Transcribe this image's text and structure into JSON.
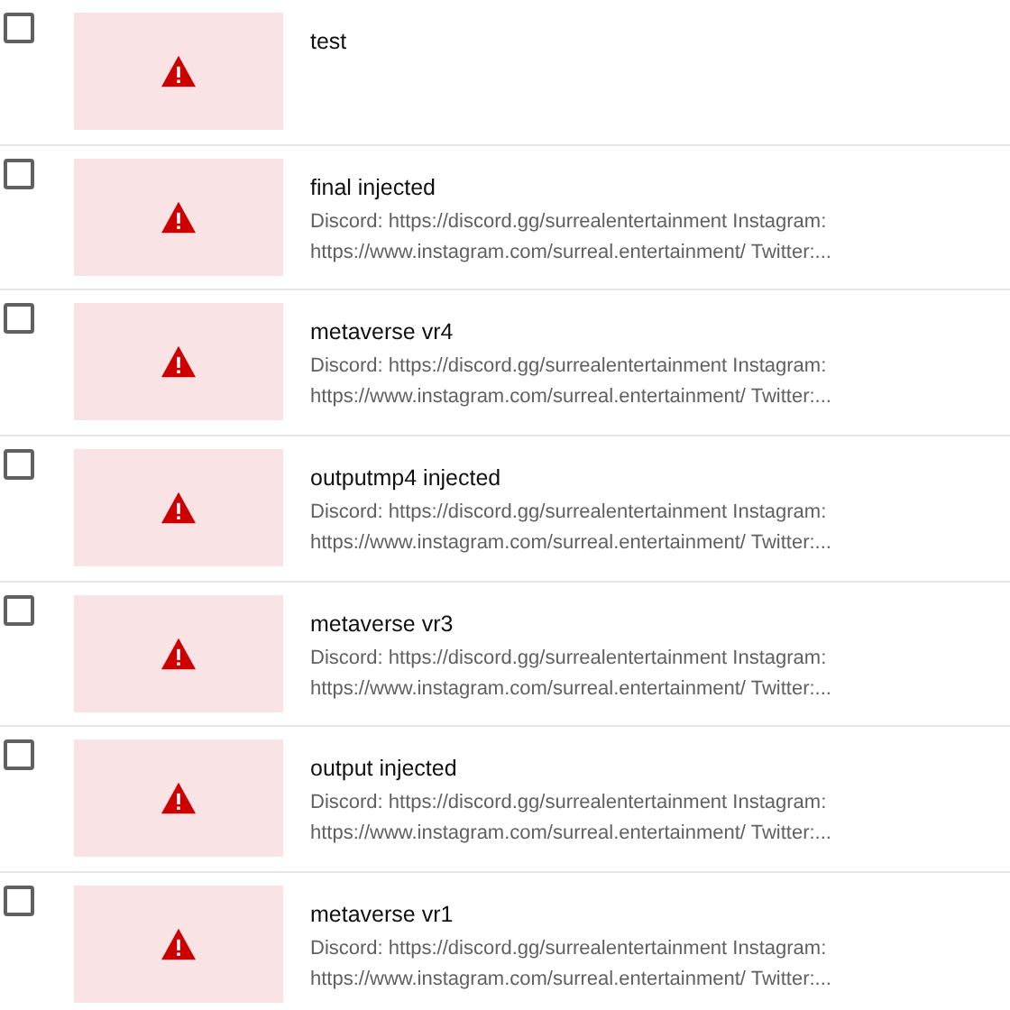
{
  "videos": [
    {
      "title": "test",
      "checked": false
    },
    {
      "title": "final injected",
      "description": "Discord: https://discord.gg/surrealentertainment Instagram: https://www.instagram.com/surreal.entertainment/ Twitter:...",
      "checked": false
    },
    {
      "title": "metaverse vr4",
      "description": "Discord: https://discord.gg/surrealentertainment Instagram: https://www.instagram.com/surreal.entertainment/ Twitter:...",
      "checked": false
    },
    {
      "title": "outputmp4 injected",
      "description": "Discord: https://discord.gg/surrealentertainment Instagram: https://www.instagram.com/surreal.entertainment/ Twitter:...",
      "checked": false
    },
    {
      "title": "metaverse vr3",
      "description": "Discord: https://discord.gg/surrealentertainment Instagram: https://www.instagram.com/surreal.entertainment/ Twitter:...",
      "checked": false
    },
    {
      "title": "output injected",
      "description": "Discord: https://discord.gg/surrealentertainment Instagram: https://www.instagram.com/surreal.entertainment/ Twitter:...",
      "checked": false
    },
    {
      "title": "metaverse vr1",
      "description": "Discord: https://discord.gg/surrealentertainment Instagram: https://www.instagram.com/surreal.entertainment/ Twitter:...",
      "checked": false
    }
  ]
}
